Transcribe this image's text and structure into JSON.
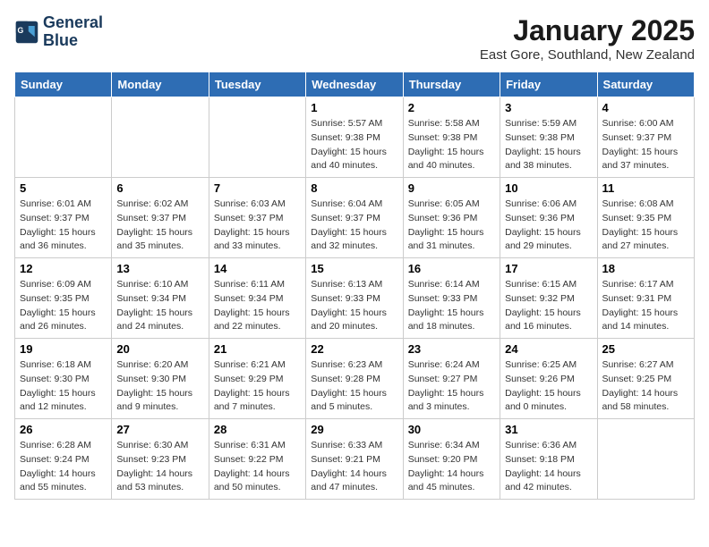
{
  "logo": {
    "line1": "General",
    "line2": "Blue"
  },
  "title": "January 2025",
  "location": "East Gore, Southland, New Zealand",
  "days_of_week": [
    "Sunday",
    "Monday",
    "Tuesday",
    "Wednesday",
    "Thursday",
    "Friday",
    "Saturday"
  ],
  "weeks": [
    [
      {
        "day": "",
        "info": ""
      },
      {
        "day": "",
        "info": ""
      },
      {
        "day": "",
        "info": ""
      },
      {
        "day": "1",
        "sunrise": "5:57 AM",
        "sunset": "9:38 PM",
        "daylight": "15 hours and 40 minutes."
      },
      {
        "day": "2",
        "sunrise": "5:58 AM",
        "sunset": "9:38 PM",
        "daylight": "15 hours and 40 minutes."
      },
      {
        "day": "3",
        "sunrise": "5:59 AM",
        "sunset": "9:38 PM",
        "daylight": "15 hours and 38 minutes."
      },
      {
        "day": "4",
        "sunrise": "6:00 AM",
        "sunset": "9:37 PM",
        "daylight": "15 hours and 37 minutes."
      }
    ],
    [
      {
        "day": "5",
        "sunrise": "6:01 AM",
        "sunset": "9:37 PM",
        "daylight": "15 hours and 36 minutes."
      },
      {
        "day": "6",
        "sunrise": "6:02 AM",
        "sunset": "9:37 PM",
        "daylight": "15 hours and 35 minutes."
      },
      {
        "day": "7",
        "sunrise": "6:03 AM",
        "sunset": "9:37 PM",
        "daylight": "15 hours and 33 minutes."
      },
      {
        "day": "8",
        "sunrise": "6:04 AM",
        "sunset": "9:37 PM",
        "daylight": "15 hours and 32 minutes."
      },
      {
        "day": "9",
        "sunrise": "6:05 AM",
        "sunset": "9:36 PM",
        "daylight": "15 hours and 31 minutes."
      },
      {
        "day": "10",
        "sunrise": "6:06 AM",
        "sunset": "9:36 PM",
        "daylight": "15 hours and 29 minutes."
      },
      {
        "day": "11",
        "sunrise": "6:08 AM",
        "sunset": "9:35 PM",
        "daylight": "15 hours and 27 minutes."
      }
    ],
    [
      {
        "day": "12",
        "sunrise": "6:09 AM",
        "sunset": "9:35 PM",
        "daylight": "15 hours and 26 minutes."
      },
      {
        "day": "13",
        "sunrise": "6:10 AM",
        "sunset": "9:34 PM",
        "daylight": "15 hours and 24 minutes."
      },
      {
        "day": "14",
        "sunrise": "6:11 AM",
        "sunset": "9:34 PM",
        "daylight": "15 hours and 22 minutes."
      },
      {
        "day": "15",
        "sunrise": "6:13 AM",
        "sunset": "9:33 PM",
        "daylight": "15 hours and 20 minutes."
      },
      {
        "day": "16",
        "sunrise": "6:14 AM",
        "sunset": "9:33 PM",
        "daylight": "15 hours and 18 minutes."
      },
      {
        "day": "17",
        "sunrise": "6:15 AM",
        "sunset": "9:32 PM",
        "daylight": "15 hours and 16 minutes."
      },
      {
        "day": "18",
        "sunrise": "6:17 AM",
        "sunset": "9:31 PM",
        "daylight": "15 hours and 14 minutes."
      }
    ],
    [
      {
        "day": "19",
        "sunrise": "6:18 AM",
        "sunset": "9:30 PM",
        "daylight": "15 hours and 12 minutes."
      },
      {
        "day": "20",
        "sunrise": "6:20 AM",
        "sunset": "9:30 PM",
        "daylight": "15 hours and 9 minutes."
      },
      {
        "day": "21",
        "sunrise": "6:21 AM",
        "sunset": "9:29 PM",
        "daylight": "15 hours and 7 minutes."
      },
      {
        "day": "22",
        "sunrise": "6:23 AM",
        "sunset": "9:28 PM",
        "daylight": "15 hours and 5 minutes."
      },
      {
        "day": "23",
        "sunrise": "6:24 AM",
        "sunset": "9:27 PM",
        "daylight": "15 hours and 3 minutes."
      },
      {
        "day": "24",
        "sunrise": "6:25 AM",
        "sunset": "9:26 PM",
        "daylight": "15 hours and 0 minutes."
      },
      {
        "day": "25",
        "sunrise": "6:27 AM",
        "sunset": "9:25 PM",
        "daylight": "14 hours and 58 minutes."
      }
    ],
    [
      {
        "day": "26",
        "sunrise": "6:28 AM",
        "sunset": "9:24 PM",
        "daylight": "14 hours and 55 minutes."
      },
      {
        "day": "27",
        "sunrise": "6:30 AM",
        "sunset": "9:23 PM",
        "daylight": "14 hours and 53 minutes."
      },
      {
        "day": "28",
        "sunrise": "6:31 AM",
        "sunset": "9:22 PM",
        "daylight": "14 hours and 50 minutes."
      },
      {
        "day": "29",
        "sunrise": "6:33 AM",
        "sunset": "9:21 PM",
        "daylight": "14 hours and 47 minutes."
      },
      {
        "day": "30",
        "sunrise": "6:34 AM",
        "sunset": "9:20 PM",
        "daylight": "14 hours and 45 minutes."
      },
      {
        "day": "31",
        "sunrise": "6:36 AM",
        "sunset": "9:18 PM",
        "daylight": "14 hours and 42 minutes."
      },
      {
        "day": "",
        "info": ""
      }
    ]
  ]
}
